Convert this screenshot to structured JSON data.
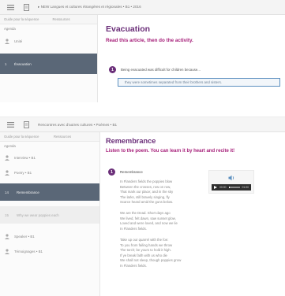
{
  "shot1": {
    "breadcrumb": "▸ NEW Langues et cultures étrangères et régionales • B1 • 2016",
    "sidebar": {
      "tabs": [
        "Guide pour la séquence",
        "Ressources"
      ],
      "title": "Agenda",
      "items": [
        {
          "label": "Unité",
          "active": false
        },
        {
          "label": "Évacuation",
          "active": true,
          "num": "1"
        }
      ]
    },
    "heading": "Evacuation",
    "instruction": "Read this article, then do the activity.",
    "step": {
      "num": "1",
      "text": "Being evacuated was difficult for children because..."
    },
    "answer": "they were sometimes separated from their brothers and sisters."
  },
  "shot2": {
    "breadcrumb": "Rencontres avec d'autres cultures • Poèmes • B1",
    "sidebar": {
      "tabs": [
        "Guide pour la séquence",
        "Ressources"
      ],
      "title": "Agenda",
      "items": [
        {
          "label": "Interview • B1",
          "state": "normal"
        },
        {
          "label": "Poetry • B1",
          "state": "normal"
        },
        {
          "label": "Remembrance",
          "state": "active",
          "num": "14"
        },
        {
          "label": "Why we wear poppies each",
          "state": "muted",
          "num": "15"
        },
        {
          "label": "Speaker • B1",
          "state": "normal"
        },
        {
          "label": "Témoignages • B1",
          "state": "normal"
        }
      ]
    },
    "heading": "Remembrance",
    "instruction": "Listen to the poem. You can learn it by heart and recite it!",
    "step": {
      "num": "1",
      "title": "Remembrance"
    },
    "stanzas": [
      "In Flanders fields the poppies blow\nBetween the crosses, row on row,\nThat mark our place; and in the sky\nThe larks, still bravely singing, fly\nScarce heard amid the guns below.",
      "We are the Dead. Short days ago\nWe lived, felt dawn, saw sunset glow,\nLoved and were loved, and now we lie\nIn Flanders fields.",
      "Take up our quarrel with the foe:\nTo you from failing hands we throw\nThe torch; be yours to hold it high.\nIf ye break faith with us who die\nWe shall not sleep, though poppies grow\nIn Flanders fields."
    ],
    "player": {
      "current_time": "00:00",
      "total_time": "01:00",
      "progress": 0.05
    }
  }
}
